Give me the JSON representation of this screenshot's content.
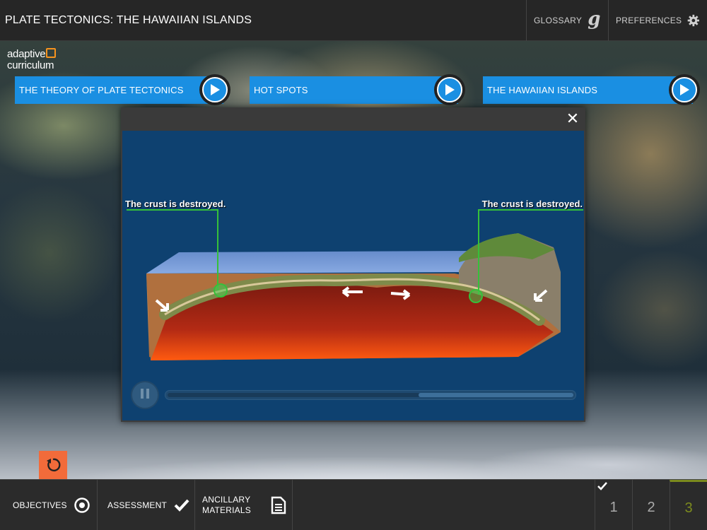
{
  "header": {
    "title": "PLATE TECTONICS: THE HAWAIIAN ISLANDS",
    "glossary_label": "GLOSSARY",
    "preferences_label": "PREFERENCES"
  },
  "logo": {
    "line1": "adaptive",
    "line2": "curriculum"
  },
  "lessons": [
    {
      "label": "THE THEORY OF PLATE TECTONICS"
    },
    {
      "label": "HOT SPOTS"
    },
    {
      "label": "THE HAWAIIAN ISLANDS"
    }
  ],
  "video": {
    "caption_left": "The crust is destroyed.",
    "caption_right": "The crust is destroyed.",
    "progress": 0.62
  },
  "footer": {
    "objectives_label": "OBJECTIVES",
    "assessment_label": "ASSESSMENT",
    "ancillary_line1": "ANCILLARY",
    "ancillary_line2": "MATERIALS",
    "pages": [
      "1",
      "2",
      "3"
    ],
    "current_page": "3"
  },
  "colors": {
    "accent_blue": "#1a8fe2",
    "reset_orange": "#f26b3a",
    "active_page": "#7c8b1e"
  },
  "icons": {
    "glossary": "glossary-g-icon",
    "preferences": "gear-icon",
    "play": "play-icon",
    "close": "close-icon",
    "pause": "pause-icon",
    "reset": "reset-icon",
    "objectives": "target-icon",
    "assessment": "checkmark-icon",
    "ancillary": "document-icon"
  }
}
